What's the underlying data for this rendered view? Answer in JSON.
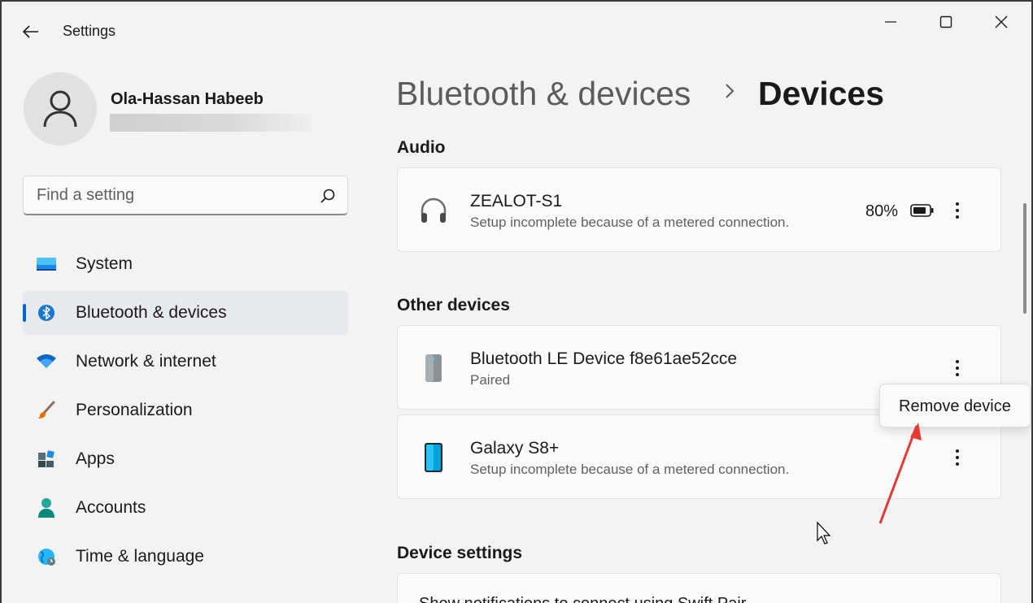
{
  "window": {
    "title": "Settings"
  },
  "profile": {
    "name": "Ola-Hassan Habeeb"
  },
  "search": {
    "placeholder": "Find a setting"
  },
  "nav": {
    "items": [
      {
        "label": "System",
        "icon": "monitor-icon"
      },
      {
        "label": "Bluetooth & devices",
        "icon": "bluetooth-icon",
        "active": true
      },
      {
        "label": "Network & internet",
        "icon": "wifi-icon"
      },
      {
        "label": "Personalization",
        "icon": "brush-icon"
      },
      {
        "label": "Apps",
        "icon": "apps-icon"
      },
      {
        "label": "Accounts",
        "icon": "person-icon"
      },
      {
        "label": "Time & language",
        "icon": "globe-icon"
      }
    ]
  },
  "breadcrumb": {
    "parent": "Bluetooth & devices",
    "current": "Devices"
  },
  "sections": {
    "audio": {
      "title": "Audio",
      "device": {
        "name": "ZEALOT-S1",
        "status": "Setup incomplete because of a metered connection.",
        "battery": "80%",
        "icon": "headphones-icon"
      }
    },
    "other": {
      "title": "Other devices",
      "devices": [
        {
          "name": "Bluetooth LE Device f8e61ae52cce",
          "status": "Paired",
          "icon": "device-tower-icon"
        },
        {
          "name": "Galaxy S8+",
          "status": "Setup incomplete because of a metered connection.",
          "icon": "phone-icon"
        }
      ]
    },
    "settings": {
      "title": "Device settings",
      "first_row": "Show notifications to connect using Swift Pair"
    }
  },
  "context_menu": {
    "item": "Remove device"
  },
  "colors": {
    "accent": "#0067c0",
    "annotation": "#e53935"
  }
}
